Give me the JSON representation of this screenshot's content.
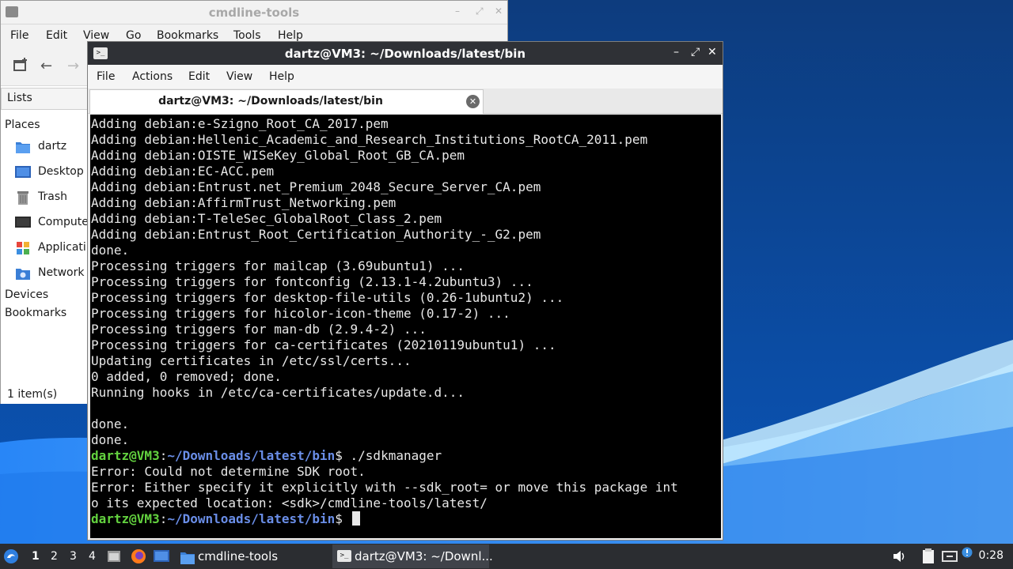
{
  "file_manager": {
    "title": "cmdline-tools",
    "menu": [
      "File",
      "Edit",
      "View",
      "Go",
      "Bookmarks",
      "Tools",
      "Help"
    ],
    "sidebar": {
      "mode_label": "Lists",
      "places_header": "Places",
      "places": [
        {
          "label": "dartz",
          "icon": "home-folder-icon"
        },
        {
          "label": "Desktop",
          "icon": "desktop-icon"
        },
        {
          "label": "Trash",
          "icon": "trash-icon"
        },
        {
          "label": "Compute",
          "icon": "computer-icon"
        },
        {
          "label": "Applicati",
          "icon": "applications-icon"
        },
        {
          "label": "Network",
          "icon": "network-icon"
        }
      ],
      "devices_header": "Devices",
      "bookmarks_header": "Bookmarks"
    },
    "status": "1 item(s)"
  },
  "terminal": {
    "title": "dartz@VM3: ~/Downloads/latest/bin",
    "menu": [
      "File",
      "Actions",
      "Edit",
      "View",
      "Help"
    ],
    "tab_label": "dartz@VM3: ~/Downloads/latest/bin",
    "lines": [
      "Adding debian:e-Szigno_Root_CA_2017.pem",
      "Adding debian:Hellenic_Academic_and_Research_Institutions_RootCA_2011.pem",
      "Adding debian:OISTE_WISeKey_Global_Root_GB_CA.pem",
      "Adding debian:EC-ACC.pem",
      "Adding debian:Entrust.net_Premium_2048_Secure_Server_CA.pem",
      "Adding debian:AffirmTrust_Networking.pem",
      "Adding debian:T-TeleSec_GlobalRoot_Class_2.pem",
      "Adding debian:Entrust_Root_Certification_Authority_-_G2.pem",
      "done.",
      "Processing triggers for mailcap (3.69ubuntu1) ...",
      "Processing triggers for fontconfig (2.13.1-4.2ubuntu3) ...",
      "Processing triggers for desktop-file-utils (0.26-1ubuntu2) ...",
      "Processing triggers for hicolor-icon-theme (0.17-2) ...",
      "Processing triggers for man-db (2.9.4-2) ...",
      "Processing triggers for ca-certificates (20210119ubuntu1) ...",
      "Updating certificates in /etc/ssl/certs...",
      "0 added, 0 removed; done.",
      "Running hooks in /etc/ca-certificates/update.d...",
      "",
      "done.",
      "done."
    ],
    "prompt": {
      "user_host": "dartz@VM3",
      "colon": ":",
      "path": "~/Downloads/latest/bin",
      "symbol": "$ "
    },
    "command": "./sdkmanager",
    "error_lines": [
      "Error: Could not determine SDK root.",
      "Error: Either specify it explicitly with --sdk_root= or move this package int",
      "o its expected location: <sdk>/cmdline-tools/latest/"
    ]
  },
  "taskbar": {
    "workspaces": [
      "1",
      "2",
      "3",
      "4"
    ],
    "active_workspace": "1",
    "tasks": [
      {
        "label": "cmdline-tools",
        "icon": "folder-icon"
      },
      {
        "label": "dartz@VM3: ~/Downl...",
        "icon": "terminal-icon"
      }
    ],
    "clock": "0:28"
  },
  "colors": {
    "wallpaper": "#0a3a7a",
    "prompt_user": "#63d23f",
    "prompt_path": "#6a8ee8",
    "terminal_bg": "#000000",
    "titlebar_dark": "#2f3136"
  }
}
